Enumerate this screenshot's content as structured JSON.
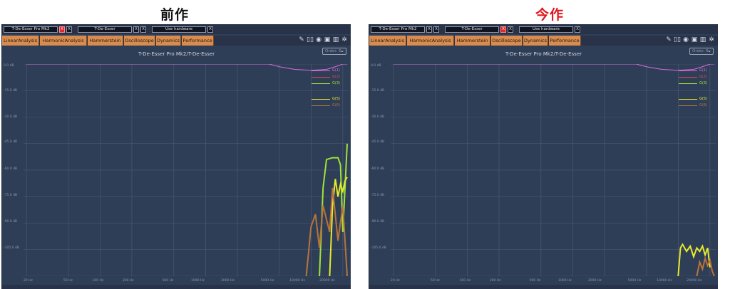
{
  "headings": {
    "before": "前作",
    "after": "今作"
  },
  "panels": [
    {
      "toolbar": {
        "plugin1": "T-De-Esser Pro Mk2",
        "plugin2": "T-De-Esser",
        "hardware": "Use hardware",
        "x": "X"
      },
      "active_close": "plugin1",
      "tabs": [
        "LinearAnalysis",
        "HarmonicAnalysis",
        "Hammerstein",
        "Oscilloscope",
        "Dynamics",
        "Performance"
      ],
      "plot_title": "T-De-Esser Pro Mk2/T-De-Esser",
      "order_label": "Order: 6",
      "y_labels": [
        "0.0 dB",
        "-15.0 dB",
        "-30.0 dB",
        "-45.0 dB",
        "-60.0 dB",
        "-75.0 dB",
        "-90.0 dB",
        "-105.0 dB"
      ],
      "x_labels": [
        "20 Hz",
        "50 Hz",
        "100 Hz",
        "200 Hz",
        "500 Hz",
        "1000 Hz",
        "2000 Hz",
        "5000 Hz",
        "10000 Hz",
        "20000 Hz"
      ],
      "legend": [
        {
          "label": "G(1)",
          "color": "#d86cd8"
        },
        {
          "label": "G(2)",
          "color": "#d94c4c"
        },
        {
          "label": "G(3)",
          "color": "#9fe33a"
        },
        {
          "label": "G(5)",
          "color": "#e6ea2a"
        },
        {
          "label": "G(6)",
          "color": "#b8743a"
        }
      ]
    },
    {
      "toolbar": {
        "plugin1": "T-De-Esser Pro Mk2",
        "plugin2": "T-De-Esser",
        "hardware": "Use hardware",
        "x": "X"
      },
      "active_close": "plugin2",
      "tabs": [
        "LinearAnalysis",
        "HarmonicAnalysis",
        "Hammerstein",
        "Oscilloscope",
        "Dynamics",
        "Performance"
      ],
      "plot_title": "T-De-Esser Pro Mk2/T-De-Esser",
      "order_label": "Order: 6",
      "y_labels": [
        "0.0 dB",
        "-15.0 dB",
        "-30.0 dB",
        "-45.0 dB",
        "-60.0 dB",
        "-75.0 dB",
        "-90.0 dB",
        "-105.0 dB"
      ],
      "x_labels": [
        "20 Hz",
        "50 Hz",
        "100 Hz",
        "200 Hz",
        "500 Hz",
        "1000 Hz",
        "2000 Hz",
        "5000 Hz",
        "10000 Hz",
        "20000 Hz"
      ],
      "legend": [
        {
          "label": "G(1)",
          "color": "#d86cd8"
        },
        {
          "label": "G(2)",
          "color": "#d94c4c"
        },
        {
          "label": "G(3)",
          "color": "#9fe33a"
        },
        {
          "label": "G(5)",
          "color": "#e6ea2a"
        },
        {
          "label": "G(6)",
          "color": "#b8743a"
        }
      ]
    }
  ],
  "icons": [
    "edit-icon",
    "book-icon",
    "eye-icon",
    "camera-icon",
    "bars-icon",
    "gear-icon"
  ],
  "colors": {
    "panel_bg": "#2f3e57",
    "grid": "#4d5d79",
    "tab": "#d98c4e",
    "fundamental": "#d86cd8",
    "close_active": "#e3262b"
  },
  "chart_data": [
    {
      "type": "line",
      "xscale": "log",
      "xlim": [
        20,
        22000
      ],
      "ylim": [
        -120,
        0
      ],
      "grid": true,
      "legend": "top-right",
      "series": [
        {
          "name": "G(1)",
          "x": [
            20,
            4000,
            5000,
            7000,
            10000,
            14000,
            18000,
            20000,
            22000
          ],
          "y": [
            0,
            0,
            -1.5,
            -3,
            -3.5,
            -3,
            -1,
            0,
            0
          ]
        },
        {
          "name": "G(3)",
          "x": [
            12000,
            13000,
            14000,
            16000,
            18000,
            19000,
            20000,
            22000
          ],
          "y": [
            -120,
            -70,
            -54,
            -53,
            -53,
            -57,
            -95,
            -45
          ]
        },
        {
          "name": "G(5)",
          "x": [
            15000,
            16000,
            17000,
            18000,
            19000,
            20000,
            21000,
            22000
          ],
          "y": [
            -120,
            -80,
            -65,
            -75,
            -68,
            -72,
            -66,
            -64
          ]
        },
        {
          "name": "G(6)",
          "x": [
            9000,
            10000,
            11000,
            12000,
            13000,
            14000,
            15000,
            16000,
            18000,
            20000,
            22000
          ],
          "y": [
            -120,
            -92,
            -85,
            -104,
            -80,
            -88,
            -95,
            -70,
            -100,
            -80,
            -120
          ]
        }
      ]
    },
    {
      "type": "line",
      "xscale": "log",
      "xlim": [
        20,
        22000
      ],
      "ylim": [
        -120,
        0
      ],
      "grid": true,
      "legend": "top-right",
      "series": [
        {
          "name": "G(1)",
          "x": [
            20,
            4000,
            5000,
            7000,
            10000,
            14000,
            18000,
            20000,
            22000
          ],
          "y": [
            0,
            0,
            -1.5,
            -3,
            -3.5,
            -3,
            -1,
            0,
            0
          ]
        },
        {
          "name": "G(5)",
          "x": [
            10000,
            10500,
            11000,
            12000,
            13000,
            14000,
            15000,
            16000,
            17000,
            18000,
            19000,
            20000
          ],
          "y": [
            -120,
            -104,
            -102,
            -106,
            -103,
            -109,
            -104,
            -106,
            -103,
            -108,
            -104,
            -115
          ]
        },
        {
          "name": "G(6)",
          "x": [
            15000,
            16000,
            17000,
            18000,
            19000,
            20000,
            21000,
            22000
          ],
          "y": [
            -120,
            -112,
            -116,
            -110,
            -114,
            -111,
            -117,
            -120
          ]
        }
      ]
    }
  ]
}
